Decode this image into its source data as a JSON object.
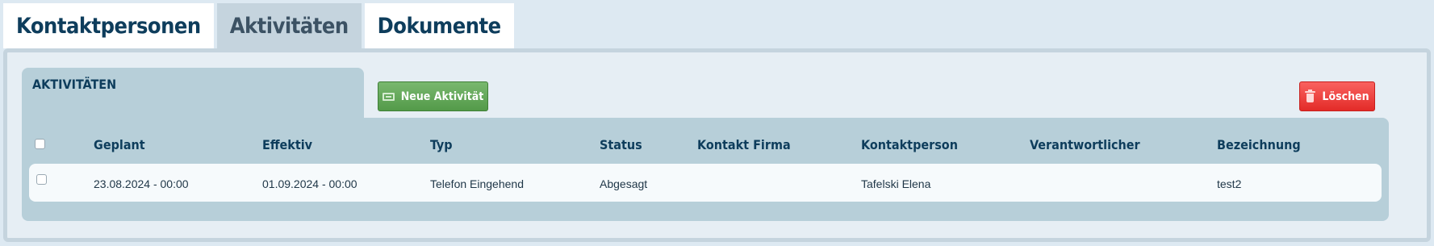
{
  "tabs": [
    {
      "label": "Kontaktpersonen",
      "active": false
    },
    {
      "label": "Aktivitäten",
      "active": true
    },
    {
      "label": "Dokumente",
      "active": false
    }
  ],
  "section": {
    "title": "AKTIVITÄTEN",
    "new_button": {
      "label": "Neue Aktivität",
      "icon": "screen-icon"
    },
    "delete_button": {
      "label": "Löschen",
      "icon": "trash-icon"
    }
  },
  "table": {
    "columns": [
      "Geplant",
      "Effektiv",
      "Typ",
      "Status",
      "Kontakt Firma",
      "Kontaktperson",
      "Verantwortlicher",
      "Bezeichnung"
    ],
    "rows": [
      {
        "checked": false,
        "cells": [
          "23.08.2024 - 00:00",
          "01.09.2024 - 00:00",
          "Telefon Eingehend",
          "Abgesagt",
          "",
          "Tafelski Elena",
          "",
          "test2"
        ]
      }
    ]
  },
  "colors": {
    "accent_dark": "#0e3d5c",
    "section_bg": "#b7cfd9",
    "new_button": "#5fa455",
    "delete_button": "#ef3d3a"
  }
}
